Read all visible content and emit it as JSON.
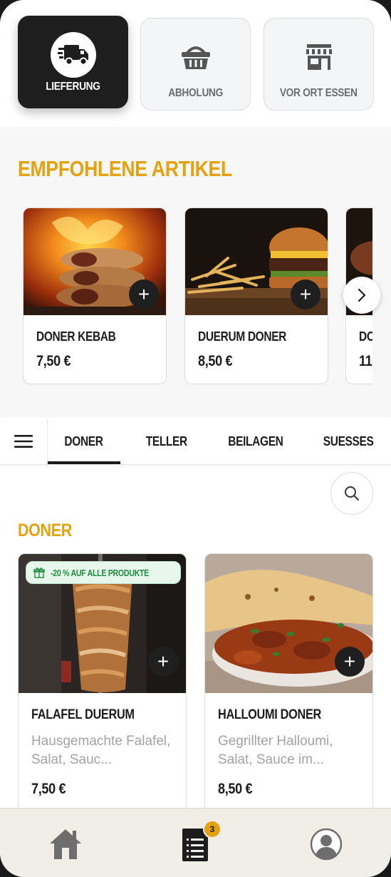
{
  "delivery_modes": [
    {
      "label": "LIEFERUNG",
      "icon": "truck-icon",
      "active": true
    },
    {
      "label": "ABHOLUNG",
      "icon": "basket-icon",
      "active": false
    },
    {
      "label": "VOR ORT ESSEN",
      "icon": "store-icon",
      "active": false
    }
  ],
  "recommended": {
    "title": "EMPFOHLENE ARTIKEL",
    "items": [
      {
        "name": "DONER KEBAB",
        "price": "7,50 €"
      },
      {
        "name": "DUERUM DONER",
        "price": "8,50 €"
      },
      {
        "name": "DO",
        "price": "11"
      }
    ]
  },
  "categories": {
    "tabs": [
      {
        "label": "DONER",
        "active": true
      },
      {
        "label": "TELLER",
        "active": false
      },
      {
        "label": "BEILAGEN",
        "active": false
      },
      {
        "label": "SUESSES",
        "active": false
      }
    ]
  },
  "section": {
    "title": "DONER",
    "products": [
      {
        "name": "FALAFEL DUERUM",
        "desc": "Hausgemachte Falafel, Salat, Sauc...",
        "price": "7,50 €",
        "promo": "-20 % AUF ALLE PRODUKTE"
      },
      {
        "name": "HALLOUMI DONER",
        "desc": "Gegrillter Halloumi, Salat, Sauce im...",
        "price": "8,50 €"
      }
    ]
  },
  "bottom_nav": {
    "items": [
      {
        "icon": "home-icon"
      },
      {
        "icon": "menu-list-icon",
        "badge": "3"
      },
      {
        "icon": "profile-icon"
      }
    ]
  },
  "colors": {
    "accent": "#e3a20e",
    "dark": "#1e1e1e",
    "promo_green": "#1e8e3e"
  }
}
